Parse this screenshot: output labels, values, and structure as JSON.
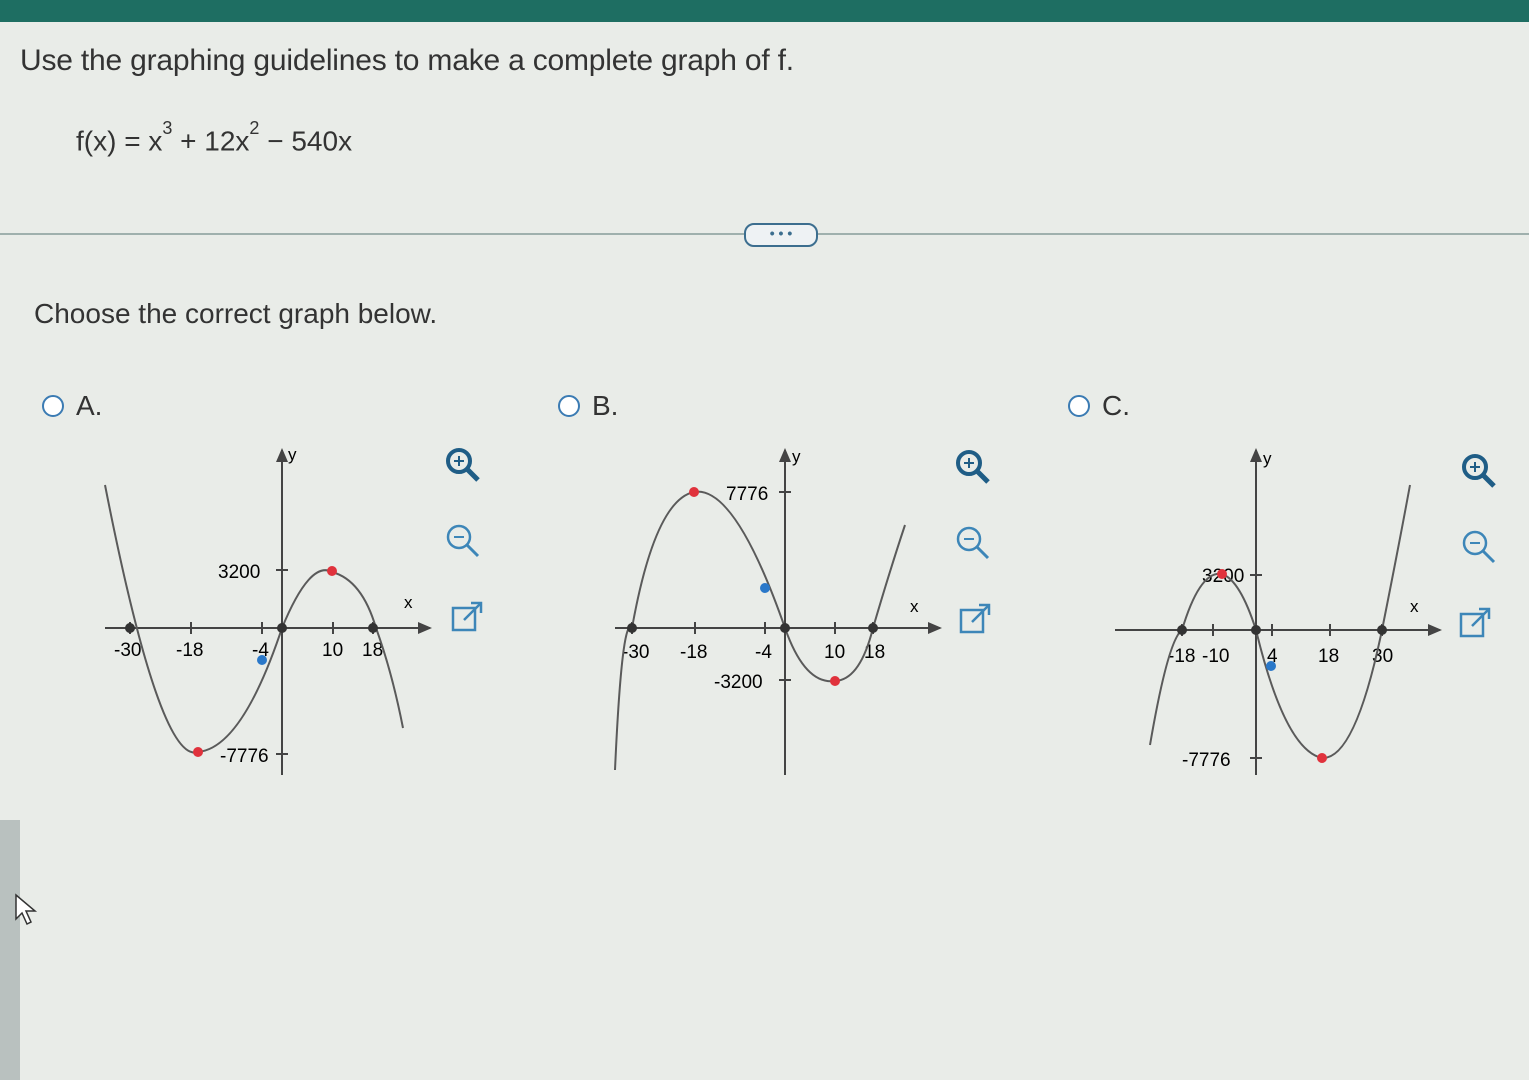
{
  "question": "Use the graphing guidelines to make a complete graph of f.",
  "formula": {
    "lhs": "f(x) = x",
    "exp1": "3",
    "mid": " + 12x",
    "exp2": "2",
    "rhs": " − 540x"
  },
  "expand_button": "• • •",
  "prompt": "Choose the correct graph below.",
  "options": [
    {
      "label": "A.",
      "axis_x": "x",
      "axis_y": "y",
      "x_ticks": [
        "-30",
        "-18",
        "-4",
        "10",
        "18"
      ],
      "y_ticks": [
        "3200",
        "-7776"
      ]
    },
    {
      "label": "B.",
      "axis_x": "x",
      "axis_y": "y",
      "x_ticks": [
        "-30",
        "-18",
        "-4",
        "10",
        "18"
      ],
      "y_ticks": [
        "7776",
        "-3200"
      ]
    },
    {
      "label": "C.",
      "axis_x": "x",
      "axis_y": "y",
      "x_ticks": [
        "-18",
        "-10",
        "4",
        "18",
        "30"
      ],
      "y_ticks": [
        "3200",
        "-7776"
      ]
    }
  ],
  "tools": {
    "zoom_in": "zoom-in-icon",
    "zoom_out": "zoom-out-icon",
    "popout": "popout-icon"
  },
  "colors": {
    "accent": "#1e6e62",
    "curve": "#5a5a5a",
    "extremum_point": "#e0323c",
    "inflection_point": "#2a78c9",
    "radio": "#3b7bb3"
  }
}
